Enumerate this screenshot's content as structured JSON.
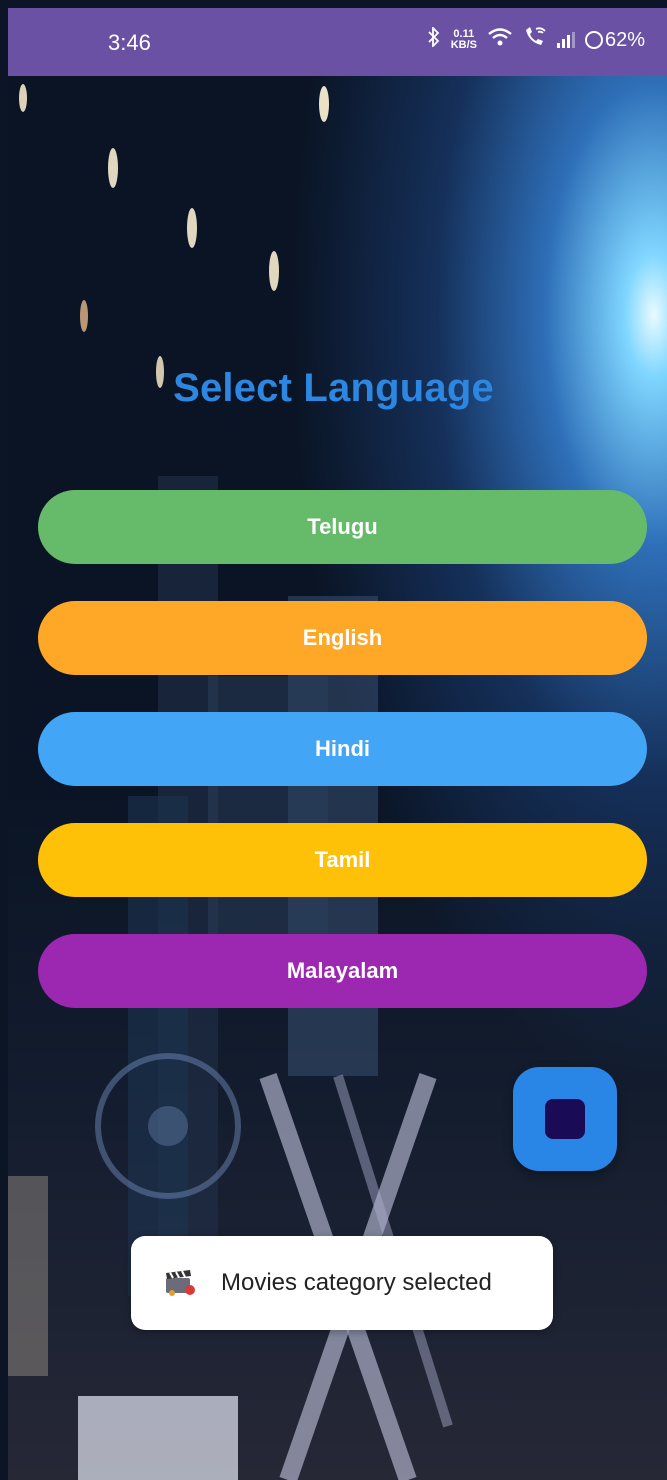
{
  "status_bar": {
    "time": "3:46",
    "net_speed_value": "0.11",
    "net_speed_unit": "KB/S",
    "battery": "62%",
    "color": "#6a51a3"
  },
  "page": {
    "title": "Select Language",
    "title_color": "#2d86e0"
  },
  "languages": [
    {
      "label": "Telugu",
      "color": "#66bb6a"
    },
    {
      "label": "English",
      "color": "#ffa726"
    },
    {
      "label": "Hindi",
      "color": "#42a5f5"
    },
    {
      "label": "Tamil",
      "color": "#ffc107"
    },
    {
      "label": "Malayalam",
      "color": "#9c27b0"
    }
  ],
  "fab": {
    "icon": "stop-icon",
    "color": "#2986e6"
  },
  "toast": {
    "icon": "movie-clapper-icon",
    "message": "Movies category selected"
  }
}
